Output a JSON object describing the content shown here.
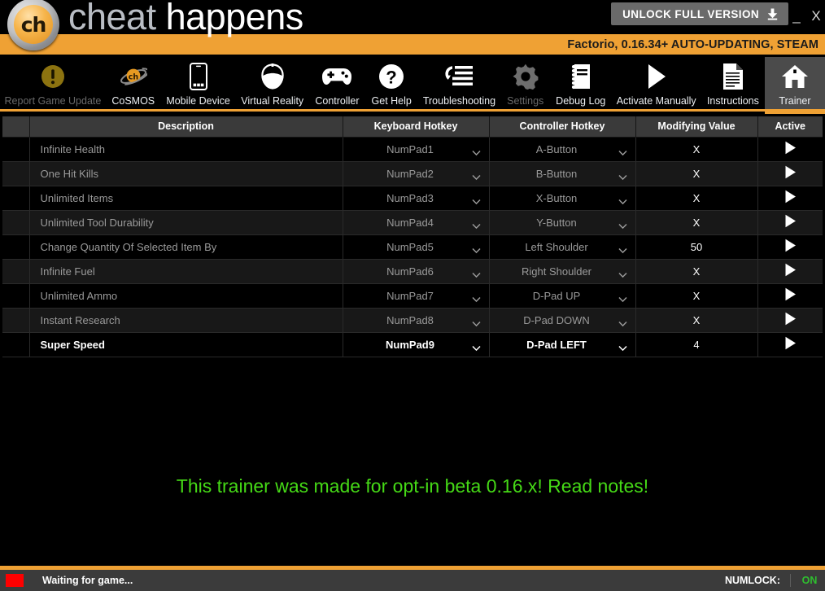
{
  "titlebar": {
    "logo_text": "ch",
    "brand_part1": "cheat",
    "brand_part2": "happens",
    "unlock_label": "UNLOCK FULL VERSION",
    "download_icon": "download-icon",
    "minimize_label": "_",
    "close_label": "X"
  },
  "gamebar": {
    "game_info": "Factorio, 0.16.34+ AUTO-UPDATING, STEAM",
    "accent_color": "#efa134"
  },
  "toolbar": {
    "items": [
      {
        "label": "Trainer",
        "icon": "home-icon",
        "active": true,
        "disabled": false
      },
      {
        "label": "Instructions",
        "icon": "document-icon",
        "active": false,
        "disabled": false
      },
      {
        "label": "Activate Manually",
        "icon": "play-icon",
        "active": false,
        "disabled": false
      },
      {
        "label": "Debug Log",
        "icon": "notebook-icon",
        "active": false,
        "disabled": false
      },
      {
        "label": "Settings",
        "icon": "gear-icon",
        "active": false,
        "disabled": true
      },
      {
        "label": "Troubleshooting",
        "icon": "list-refresh-icon",
        "active": false,
        "disabled": false
      },
      {
        "label": "Get Help",
        "icon": "question-icon",
        "active": false,
        "disabled": false
      },
      {
        "label": "Controller",
        "icon": "gamepad-icon",
        "active": false,
        "disabled": false
      },
      {
        "label": "Virtual Reality",
        "icon": "vr-headset-icon",
        "active": false,
        "disabled": false
      },
      {
        "label": "Mobile Device",
        "icon": "phone-icon",
        "active": false,
        "disabled": false
      },
      {
        "label": "CoSMOS",
        "icon": "cosmos-icon",
        "active": false,
        "disabled": false
      },
      {
        "label": "Report Game Update",
        "icon": "warning-icon",
        "active": false,
        "disabled": true
      }
    ]
  },
  "table": {
    "columns": [
      "",
      "Description",
      "Keyboard Hotkey",
      "Controller Hotkey",
      "Modifying Value",
      "Active"
    ],
    "rows": [
      {
        "description": "Infinite Health",
        "keyboard": "NumPad1",
        "controller": "A-Button",
        "value": "X",
        "active": true,
        "highlight": false
      },
      {
        "description": "One Hit Kills",
        "keyboard": "NumPad2",
        "controller": "B-Button",
        "value": "X",
        "active": true,
        "highlight": false
      },
      {
        "description": "Unlimited Items",
        "keyboard": "NumPad3",
        "controller": "X-Button",
        "value": "X",
        "active": true,
        "highlight": false
      },
      {
        "description": "Unlimited Tool Durability",
        "keyboard": "NumPad4",
        "controller": "Y-Button",
        "value": "X",
        "active": true,
        "highlight": false
      },
      {
        "description": "Change Quantity Of Selected Item By",
        "keyboard": "NumPad5",
        "controller": "Left Shoulder",
        "value": "50",
        "active": true,
        "highlight": false
      },
      {
        "description": "Infinite Fuel",
        "keyboard": "NumPad6",
        "controller": "Right Shoulder",
        "value": "X",
        "active": true,
        "highlight": false
      },
      {
        "description": "Unlimited Ammo",
        "keyboard": "NumPad7",
        "controller": "D-Pad UP",
        "value": "X",
        "active": true,
        "highlight": false
      },
      {
        "description": "Instant Research",
        "keyboard": "NumPad8",
        "controller": "D-Pad DOWN",
        "value": "X",
        "active": true,
        "highlight": false
      },
      {
        "description": "Super Speed",
        "keyboard": "NumPad9",
        "controller": "D-Pad LEFT",
        "value": "4",
        "active": true,
        "highlight": true
      }
    ]
  },
  "notice": {
    "message": "This trainer was made for opt-in beta 0.16.x! Read notes!",
    "color": "#45d916"
  },
  "statusbar": {
    "swatch_color": "#fe0000",
    "status_text": "Waiting for game...",
    "numlock_label": "NUMLOCK:",
    "numlock_value": "ON",
    "numlock_color": "#2fbf2f"
  }
}
